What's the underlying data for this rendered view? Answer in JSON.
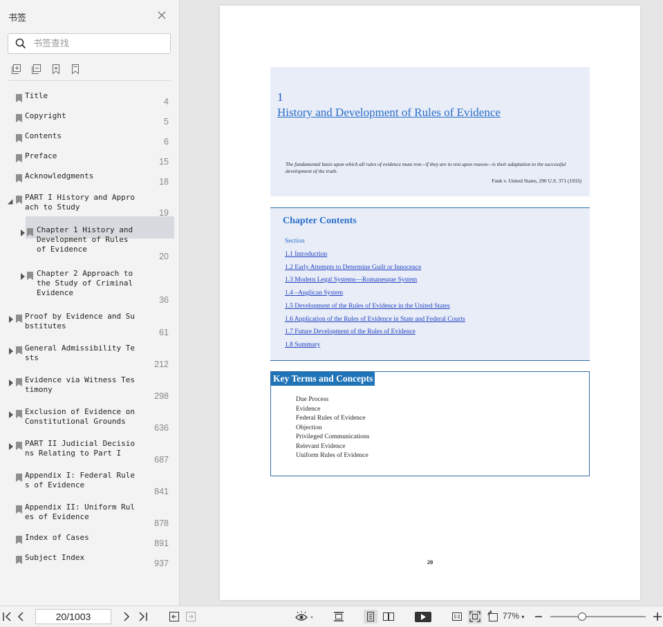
{
  "sidebar": {
    "title": "书签",
    "search_placeholder": "书签查找",
    "bookmarks": [
      {
        "label": "Title",
        "page": "4"
      },
      {
        "label": "Copyright",
        "page": "5"
      },
      {
        "label": "Contents",
        "page": "6"
      },
      {
        "label": "Preface",
        "page": "15"
      },
      {
        "label": "Acknowledgments",
        "page": "18"
      },
      {
        "label": "PART I History and Appro\nach to Study",
        "page": "19"
      },
      {
        "label": "Chapter 1 History and\nDevelopment of Rules\nof Evidence",
        "page": "20"
      },
      {
        "label": "Chapter 2 Approach to\nthe Study of Criminal\nEvidence",
        "page": "36"
      },
      {
        "label": "Proof by Evidence and Su\nbstitutes",
        "page": "61"
      },
      {
        "label": "General Admissibility Te\nsts",
        "page": "212"
      },
      {
        "label": "Evidence via Witness Tes\ntimony",
        "page": "298"
      },
      {
        "label": "Exclusion of Evidence on\nConstitutional Grounds",
        "page": "636"
      },
      {
        "label": "PART II Judicial Decisio\nns Relating to Part I",
        "page": "687"
      },
      {
        "label": "Appendix I: Federal Rule\ns of Evidence",
        "page": "841"
      },
      {
        "label": "Appendix II: Uniform Rul\nes of Evidence",
        "page": "878"
      },
      {
        "label": "Index of Cases",
        "page": "891"
      },
      {
        "label": "Subject Index",
        "page": "937"
      }
    ]
  },
  "document": {
    "chapter_number": "1",
    "chapter_title": "History and Development of Rules of Evidence",
    "epigraph": "The fundamental basis upon which all rules of evidence must rest—if they are to rest upon reason—is their adaptation to the successful development of the truth.",
    "citation": "Funk v. United States, 290 U.S. 371 (1933)",
    "contents_title": "Chapter Contents",
    "contents_section": "Section",
    "contents_items": [
      "1.1 Introduction",
      "1.2 Early Attempts to Determine Guilt or Innocence",
      "1.3 Modern Legal Systems—Romanesque System",
      "1.4 –Anglican System",
      "1.5 Development of the Rules of Evidence in the United States",
      "1.6 Application of the Rules of Evidence in State and Federal Courts",
      "1.7 Future Development of the Rules of Evidence",
      "1.8 Summary"
    ],
    "key_terms_title": "Key Terms and Concepts",
    "key_terms": [
      "Due Process",
      "Evidence",
      "Federal Rules of Evidence",
      "Objection",
      "Privileged Communications",
      "Relevant Evidence",
      "Uniform Rules of Evidence"
    ],
    "page_number": "20"
  },
  "toolbar": {
    "page_indicator": "20/1003",
    "zoom": "77%",
    "zoom_level": 0.33
  }
}
